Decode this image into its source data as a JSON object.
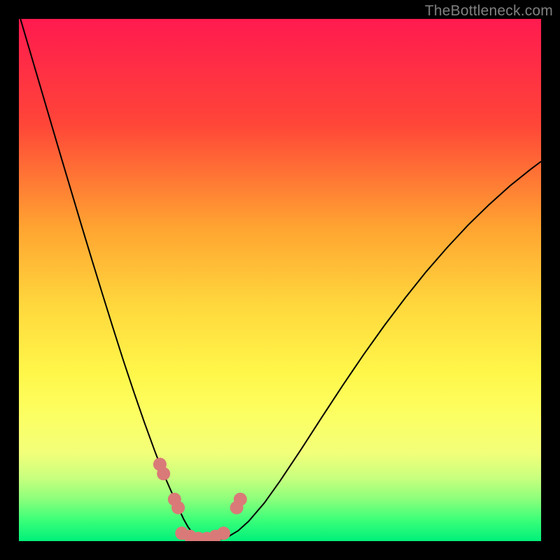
{
  "watermark": "TheBottleneck.com",
  "chart_data": {
    "type": "line",
    "title": "",
    "xlabel": "",
    "ylabel": "",
    "xlim": [
      0,
      100
    ],
    "ylim": [
      0,
      100
    ],
    "background_gradient": {
      "stops": [
        {
          "offset": 0,
          "color": "#ff1a4f"
        },
        {
          "offset": 20,
          "color": "#ff4538"
        },
        {
          "offset": 40,
          "color": "#ffa431"
        },
        {
          "offset": 55,
          "color": "#ffd83d"
        },
        {
          "offset": 68,
          "color": "#fff74a"
        },
        {
          "offset": 76,
          "color": "#fcff63"
        },
        {
          "offset": 83,
          "color": "#f3ff79"
        },
        {
          "offset": 88,
          "color": "#c7ff7e"
        },
        {
          "offset": 92,
          "color": "#8bff7b"
        },
        {
          "offset": 96,
          "color": "#3bff79"
        },
        {
          "offset": 100,
          "color": "#00f07a"
        }
      ]
    },
    "series": [
      {
        "name": "bottleneck-curve",
        "color": "#000000",
        "stroke_width": 2,
        "x": [
          0,
          2,
          4,
          6,
          8,
          10,
          12,
          14,
          16,
          18,
          20,
          22,
          24,
          26,
          27,
          28,
          29,
          30,
          30.8,
          31.6,
          32.4,
          33.2,
          34,
          34.8,
          35.8,
          37,
          38.4,
          40,
          42,
          44,
          47,
          50,
          54,
          58,
          62,
          66,
          70,
          74,
          78,
          82,
          86,
          90,
          94,
          98,
          100
        ],
        "y": [
          101,
          94.2,
          87.4,
          80.6,
          73.8,
          67.1,
          60.4,
          53.8,
          47.3,
          40.9,
          34.6,
          28.6,
          22.8,
          17.3,
          14.7,
          12.2,
          9.9,
          7.7,
          5.8,
          4.1,
          2.7,
          1.6,
          0.8,
          0.3,
          0.05,
          0.05,
          0.25,
          0.8,
          2.0,
          3.8,
          7.3,
          11.5,
          17.5,
          23.7,
          29.8,
          35.7,
          41.3,
          46.6,
          51.6,
          56.2,
          60.5,
          64.4,
          68.0,
          71.2,
          72.7
        ]
      }
    ],
    "markers": {
      "color": "#d97a78",
      "radius": 9.5,
      "points": [
        {
          "x": 27.0,
          "y": 14.7
        },
        {
          "x": 27.7,
          "y": 12.9
        },
        {
          "x": 29.8,
          "y": 8.0
        },
        {
          "x": 30.5,
          "y": 6.4
        },
        {
          "x": 31.2,
          "y": 1.5
        },
        {
          "x": 32.8,
          "y": 0.9
        },
        {
          "x": 34.4,
          "y": 0.5
        },
        {
          "x": 36.0,
          "y": 0.5
        },
        {
          "x": 37.6,
          "y": 0.9
        },
        {
          "x": 39.2,
          "y": 1.5
        },
        {
          "x": 41.7,
          "y": 6.4
        },
        {
          "x": 42.4,
          "y": 8.0
        }
      ]
    }
  }
}
